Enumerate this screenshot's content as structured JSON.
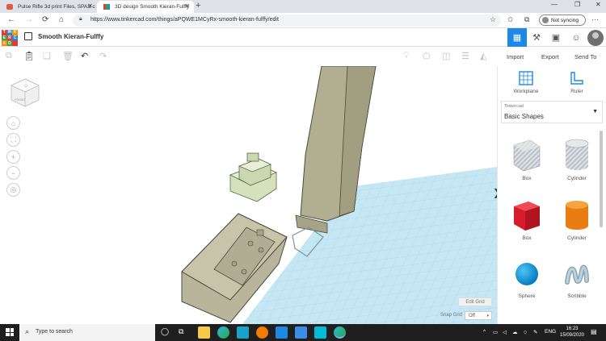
{
  "browser": {
    "tabs": [
      {
        "label": "Pulse Rifle 3d print Files, SPAS c",
        "active": false
      },
      {
        "label": "3D design Smooth Kieran-Fulffy",
        "active": true
      }
    ],
    "url": "https://www.tinkercad.com/things/aPQWE1MCyRx-smooth-kieran-fulffy/edit",
    "profile_label": "Not syncing"
  },
  "app": {
    "logo_letters": [
      "T",
      "IN",
      "K",
      "E",
      "R",
      "C",
      "A",
      "D",
      ""
    ],
    "design_title": "Smooth Kieran-Fulffy"
  },
  "actions": {
    "import": "Import",
    "export": "Export",
    "send_to": "Send To"
  },
  "panel": {
    "workplane": "Workplane",
    "ruler": "Ruler",
    "library_small": "Tinkercad",
    "library_name": "Basic Shapes",
    "shapes": [
      {
        "label": "Box",
        "icon": "box-striped-icon"
      },
      {
        "label": "Cylinder",
        "icon": "cylinder-striped-icon"
      },
      {
        "label": "Box",
        "icon": "box-red-icon"
      },
      {
        "label": "Cylinder",
        "icon": "cylinder-orange-icon"
      },
      {
        "label": "Sphere",
        "icon": "sphere-blue-icon"
      },
      {
        "label": "Scribble",
        "icon": "scribble-icon"
      }
    ]
  },
  "workspace": {
    "edit_grid": "Edit Grid",
    "snap_label": "Snap Grid",
    "snap_value": "Off",
    "viewcube_face": "FRONT"
  },
  "taskbar": {
    "search_placeholder": "Type to search",
    "language": "ENG",
    "time": "16:23",
    "date": "15/09/2020"
  },
  "colors": {
    "accent": "#1e88e5",
    "grid": "#bfe3f2",
    "model": "#b8b59a",
    "model_edge": "#4a4a3c",
    "selected": "#c9d8b0",
    "taskbar": "#1f1f1f"
  }
}
